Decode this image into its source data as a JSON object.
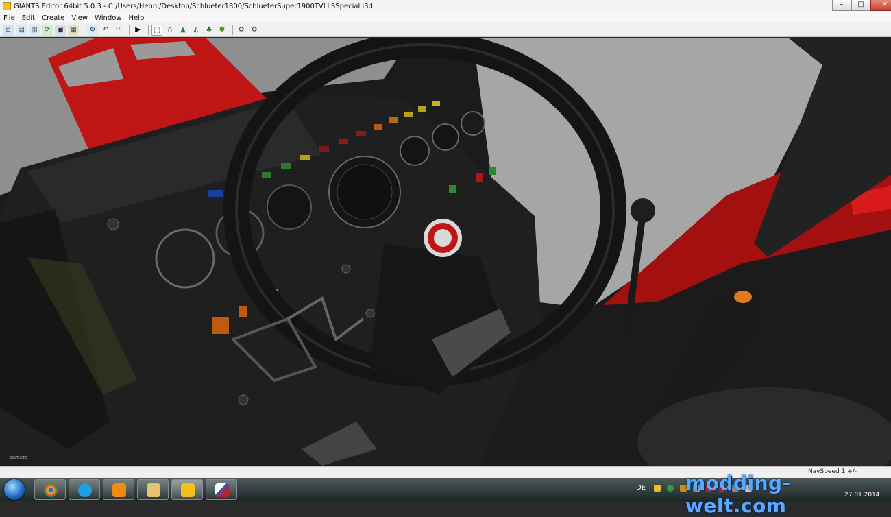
{
  "window": {
    "title": "GIANTS Editor 64bit 5.0.3 - C:/Users/Henni/Desktop/Schlueter1800/SchlueterSuper1900TVLLSSpecial.i3d",
    "controls": [
      "minimize",
      "maximize",
      "close"
    ]
  },
  "menu": {
    "items": [
      "File",
      "Edit",
      "Create",
      "View",
      "Window",
      "Help"
    ]
  },
  "toolbar": {
    "icons": [
      "new-icon",
      "open-icon",
      "save-as-icon",
      "refresh-icon",
      "save-icon",
      "export-icon",
      "reload-icon",
      "undo-icon",
      "redo-icon",
      "play-icon",
      "select-icon",
      "magnet-icon",
      "terrain-icon",
      "terrain-paint-icon",
      "foliage-icon",
      "grass-icon",
      "settings-icon",
      "settings-alt-icon"
    ]
  },
  "viewport": {
    "camera_label": "camera"
  },
  "statusbar": {
    "nav_speed": "NavSpeed 1 +/-"
  },
  "taskbar": {
    "language": "DE",
    "date": "27.01.2014",
    "apps": [
      "chrome",
      "skype",
      "media-player",
      "explorer",
      "giants-editor",
      "paint"
    ]
  },
  "watermark": "modding-welt.com",
  "colors": {
    "tractor_red": "#c81414",
    "dashboard": "#1a1a1a",
    "sky": "#a4a4a4",
    "watermark": "#5aa8ff"
  }
}
